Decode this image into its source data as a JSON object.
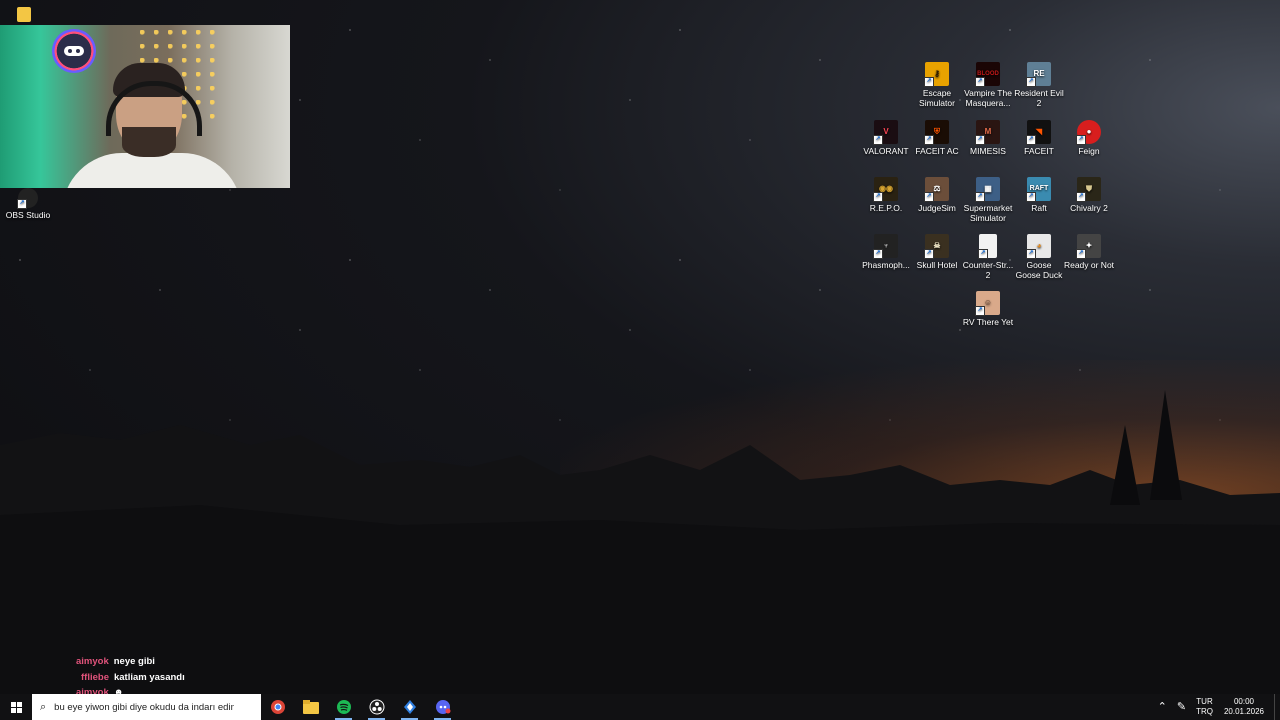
{
  "desktop": {
    "icons": [
      {
        "label": "Escape Simulator",
        "icon": "keyhole-icon",
        "color": "#e8a200"
      },
      {
        "label": "Vampire The Masquera...",
        "icon": "bloodhunt-icon",
        "color": "#c01818"
      },
      {
        "label": "Resident Evil 2",
        "icon": "resident-evil-icon",
        "color": "#5f7f95"
      },
      {
        "label": "VALORANT",
        "icon": "valorant-icon",
        "color": "#ff4655"
      },
      {
        "label": "FACEIT AC",
        "icon": "faceit-ac-icon",
        "color": "#ff5500"
      },
      {
        "label": "MIMESIS",
        "icon": "mimesis-icon",
        "color": "#b33a2a"
      },
      {
        "label": "FACEIT",
        "icon": "faceit-icon",
        "color": "#ff5500"
      },
      {
        "label": "Feign",
        "icon": "feign-icon",
        "color": "#d81e1e"
      },
      {
        "label": "R.E.P.O.",
        "icon": "repo-icon",
        "color": "#d8a530"
      },
      {
        "label": "JudgeSim",
        "icon": "judgesim-icon",
        "color": "#6b4e3a"
      },
      {
        "label": "Supermarket Simulator",
        "icon": "supermarket-icon",
        "color": "#3d5f86"
      },
      {
        "label": "Raft",
        "icon": "raft-icon",
        "color": "#3a8bb0"
      },
      {
        "label": "Chivalry 2",
        "icon": "chivalry-icon",
        "color": "#9a8a5a"
      },
      {
        "label": "Phasmoph...",
        "icon": "phasmophobia-icon",
        "color": "#222222"
      },
      {
        "label": "Skull Hotel",
        "icon": "skull-hotel-icon",
        "color": "#3a3020"
      },
      {
        "label": "Counter-Str... 2",
        "icon": "document-icon",
        "color": "#f2f2f2"
      },
      {
        "label": "Goose Goose Duck",
        "icon": "goose-icon",
        "color": "#e8e8e8"
      },
      {
        "label": "Ready or Not",
        "icon": "ready-or-not-icon",
        "color": "#444444"
      },
      {
        "label": "RV There Yet",
        "icon": "rv-icon",
        "color": "#d9a98a"
      }
    ],
    "obs_label": "OBS Studio"
  },
  "chat": [
    {
      "user": "aimyok",
      "message": "neye gibi"
    },
    {
      "user": "ffliebe",
      "message": "katliam yasandı"
    },
    {
      "user": "aimyok",
      "message": ""
    }
  ],
  "taskbar": {
    "search_text": "bu eye yiwon gibi diye okudu da indarı edim",
    "apps": [
      {
        "name": "chrome-icon",
        "color": "#db4437"
      },
      {
        "name": "file-explorer-icon",
        "color": "#f3c644"
      },
      {
        "name": "spotify-icon",
        "color": "#1db954"
      },
      {
        "name": "obs-icon",
        "color": "#ffffff"
      },
      {
        "name": "sourcetree-icon",
        "color": "#2f7fe0"
      },
      {
        "name": "discord-icon",
        "color": "#5865f2"
      }
    ],
    "language_line1": "TUR",
    "language_line2": "TRQ",
    "time": "00:00",
    "date": "20.01.2026"
  }
}
